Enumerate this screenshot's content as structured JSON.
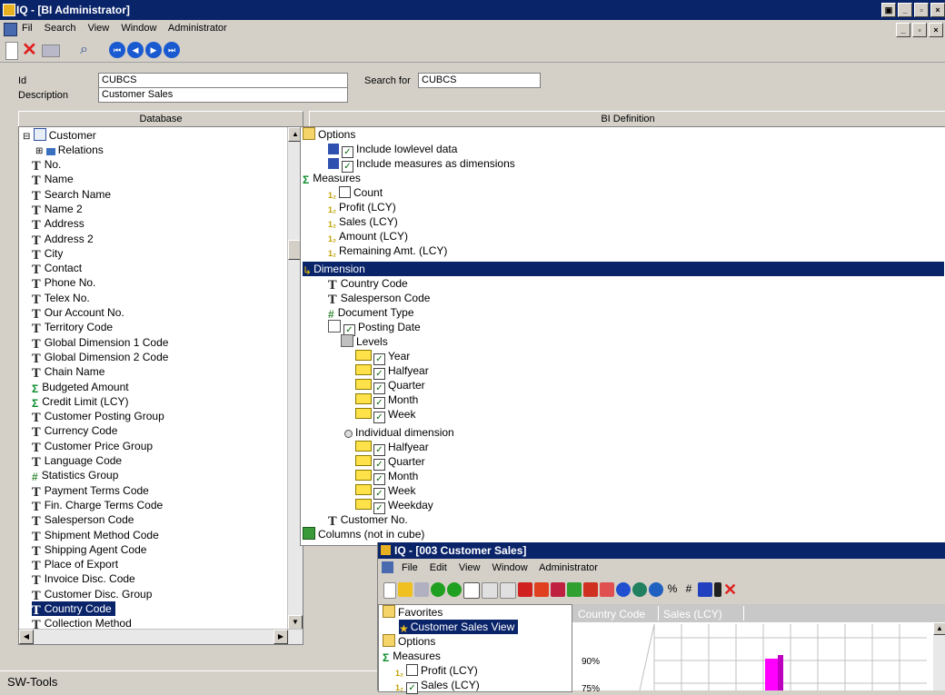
{
  "main_window": {
    "title": "IQ - [BI Administrator]",
    "menu": [
      "Fil",
      "Search",
      "View",
      "Window",
      "Administrator"
    ]
  },
  "form": {
    "id_label": "Id",
    "id_value": "CUBCS",
    "description_label": "Description",
    "description_value": "Customer Sales",
    "search_label": "Search for",
    "search_value": "CUBCS"
  },
  "database_panel": {
    "header": "Database",
    "root": "Customer",
    "relations": "Relations",
    "fields": [
      {
        "label": "No.",
        "icon": "text-field-icon"
      },
      {
        "label": "Name",
        "icon": "text-field-icon"
      },
      {
        "label": "Search Name",
        "icon": "text-field-icon"
      },
      {
        "label": "Name 2",
        "icon": "text-field-icon"
      },
      {
        "label": "Address",
        "icon": "text-field-icon"
      },
      {
        "label": "Address 2",
        "icon": "text-field-icon"
      },
      {
        "label": "City",
        "icon": "text-field-icon"
      },
      {
        "label": "Contact",
        "icon": "text-field-icon"
      },
      {
        "label": "Phone No.",
        "icon": "text-field-icon"
      },
      {
        "label": "Telex No.",
        "icon": "text-field-icon"
      },
      {
        "label": "Our Account No.",
        "icon": "text-field-icon"
      },
      {
        "label": "Territory Code",
        "icon": "text-field-icon"
      },
      {
        "label": "Global Dimension 1 Code",
        "icon": "text-field-icon"
      },
      {
        "label": "Global Dimension 2 Code",
        "icon": "text-field-icon"
      },
      {
        "label": "Chain Name",
        "icon": "text-field-icon"
      },
      {
        "label": "Budgeted Amount",
        "icon": "sum-field-icon"
      },
      {
        "label": "Credit Limit (LCY)",
        "icon": "sum-field-icon"
      },
      {
        "label": "Customer Posting Group",
        "icon": "text-field-icon"
      },
      {
        "label": "Currency Code",
        "icon": "text-field-icon"
      },
      {
        "label": "Customer Price Group",
        "icon": "text-field-icon"
      },
      {
        "label": "Language Code",
        "icon": "text-field-icon"
      },
      {
        "label": "Statistics Group",
        "icon": "hash-field-icon"
      },
      {
        "label": "Payment Terms Code",
        "icon": "text-field-icon"
      },
      {
        "label": "Fin. Charge Terms Code",
        "icon": "text-field-icon"
      },
      {
        "label": "Salesperson Code",
        "icon": "text-field-icon"
      },
      {
        "label": "Shipment Method Code",
        "icon": "text-field-icon"
      },
      {
        "label": "Shipping Agent Code",
        "icon": "text-field-icon"
      },
      {
        "label": "Place of Export",
        "icon": "text-field-icon"
      },
      {
        "label": "Invoice Disc. Code",
        "icon": "text-field-icon"
      },
      {
        "label": "Customer Disc. Group",
        "icon": "text-field-icon"
      },
      {
        "label": "Country Code",
        "icon": "text-field-icon",
        "selected": true
      },
      {
        "label": "Collection Method",
        "icon": "text-field-icon"
      }
    ]
  },
  "bi_panel": {
    "header": "BI Definition",
    "options": "Options",
    "include_lowlevel": "Include lowlevel data",
    "include_measures": "Include measures as dimensions",
    "measures": "Measures",
    "measure_items": [
      {
        "label": "Count",
        "checked": false
      },
      {
        "label": "Profit (LCY)"
      },
      {
        "label": "Sales (LCY)"
      },
      {
        "label": "Amount (LCY)"
      },
      {
        "label": "Remaining Amt. (LCY)"
      }
    ],
    "dimension": "Dimension",
    "dim_items": [
      "Country Code",
      "Salesperson Code"
    ],
    "document_type": "Document Type",
    "posting_date": "Posting Date",
    "levels": "Levels",
    "level_items": [
      "Year",
      "Halfyear",
      "Quarter",
      "Month",
      "Week"
    ],
    "individual_dimension": "Individual dimension",
    "individual_items": [
      "Halfyear",
      "Quarter",
      "Month",
      "Week",
      "Weekday"
    ],
    "customer_no": "Customer No.",
    "columns": "Columns (not in cube)"
  },
  "status_bar": "SW-Tools",
  "sub_window": {
    "title": "IQ - [003  Customer Sales]",
    "menu": [
      "File",
      "Edit",
      "View",
      "Window",
      "Administrator"
    ],
    "tree": {
      "favorites": "Favorites",
      "view": "Customer Sales View",
      "options": "Options",
      "measures": "Measures",
      "profit": "Profit (LCY)",
      "sales": "Sales (LCY)"
    },
    "chart_tabs": [
      "Country Code",
      "Sales (LCY)"
    ],
    "y_ticks": [
      "90%",
      "75%"
    ],
    "colors": {
      "bar": "#ff00ff",
      "grid_bg": "#ffffff"
    }
  }
}
